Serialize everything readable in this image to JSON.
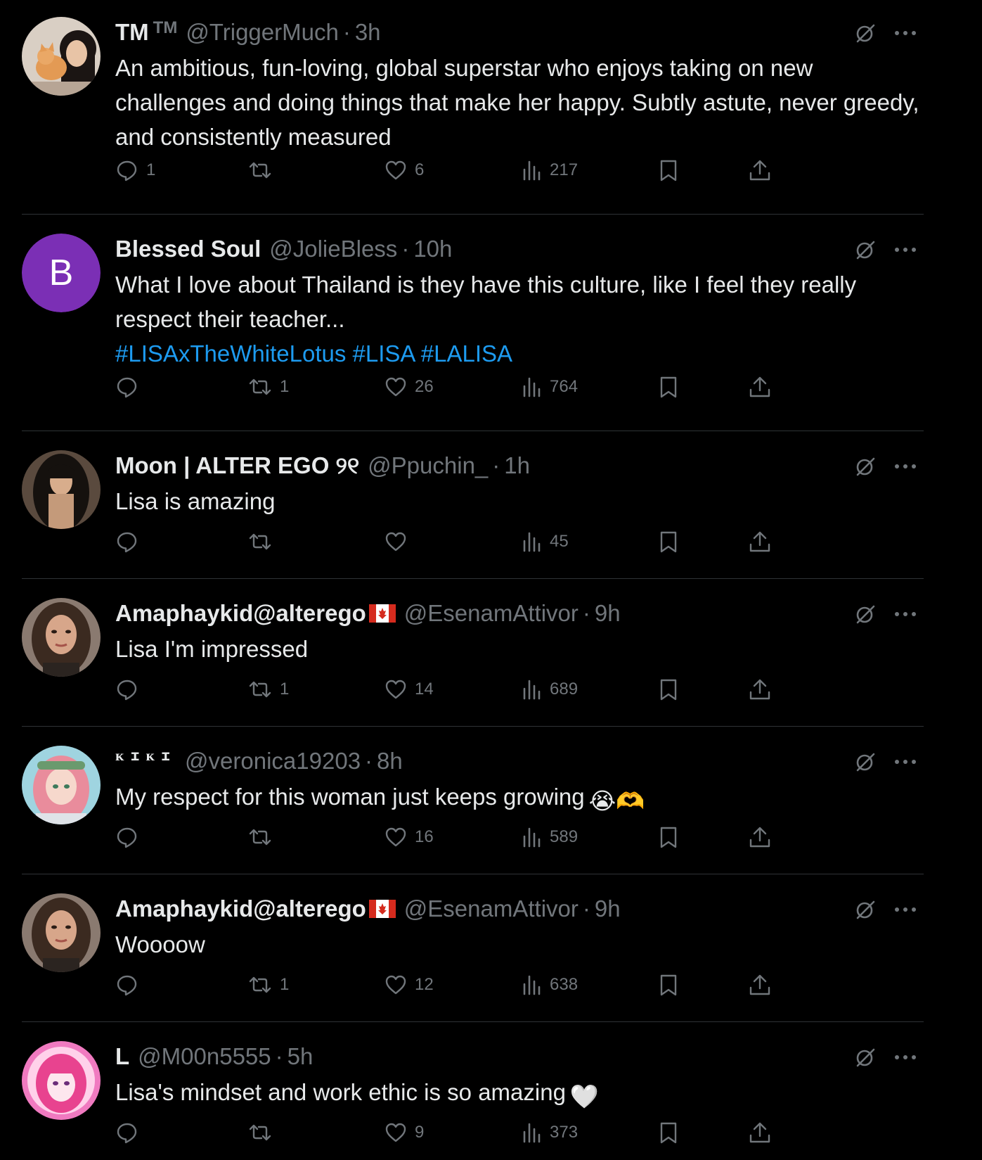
{
  "colors": {
    "background": "#000000",
    "text_primary": "#e7e9ea",
    "text_secondary": "#71767b",
    "link": "#1d9bf0",
    "divider": "#2f3336",
    "avatar_purple": "#7b2fb5"
  },
  "tweets": [
    {
      "display_name": "TM",
      "name_suffix": "TM",
      "handle": "@TriggerMuch",
      "separator": "·",
      "time": "3h",
      "text": "An ambitious, fun-loving, global superstar who enjoys taking on new challenges and doing things that make her happy. Subtly astute, never greedy, and consistently measured",
      "hashtags": "",
      "emoji": "",
      "avatar": {
        "type": "photo",
        "icon": "woman-with-cat-avatar"
      },
      "replies": "1",
      "reposts": "",
      "likes": "6",
      "views": "217"
    },
    {
      "display_name": "Blessed Soul",
      "handle": "@JolieBless",
      "separator": "·",
      "time": "10h",
      "text": "What I love about Thailand is they have this culture, like I feel they really respect their teacher...",
      "hashtags": "#LISAxTheWhiteLotus #LISA #LALISA",
      "emoji": "",
      "avatar": {
        "type": "letter",
        "letter": "B",
        "color": "#7b2fb5"
      },
      "replies": "",
      "reposts": "1",
      "likes": "26",
      "views": "764"
    },
    {
      "display_name": "Moon | ALTER EGO ୨୧",
      "handle": "@Ppuchin_",
      "separator": "·",
      "time": "1h",
      "text": "Lisa is amazing",
      "hashtags": "",
      "emoji": "",
      "avatar": {
        "type": "photo",
        "icon": "dark-hair-woman-avatar"
      },
      "replies": "",
      "reposts": "",
      "likes": "",
      "views": "45"
    },
    {
      "display_name": "Amaphaykid@alterego",
      "flag": "canada-flag-icon",
      "handle": "@EsenamAttivor",
      "separator": "·",
      "time": "9h",
      "text": "Lisa I'm impressed",
      "hashtags": "",
      "emoji": "",
      "avatar": {
        "type": "photo",
        "icon": "woman-portrait-avatar"
      },
      "replies": "",
      "reposts": "1",
      "likes": "14",
      "views": "689"
    },
    {
      "display_name": "ᴋɪᴋɪ",
      "handle": "@veronica19203",
      "separator": "·",
      "time": "8h",
      "text": "My respect for this woman just keeps growing",
      "hashtags": "",
      "emoji": "😭🫶",
      "avatar": {
        "type": "photo",
        "icon": "anime-girl-avatar"
      },
      "replies": "",
      "reposts": "",
      "likes": "16",
      "views": "589"
    },
    {
      "display_name": "Amaphaykid@alterego",
      "flag": "canada-flag-icon",
      "handle": "@EsenamAttivor",
      "separator": "·",
      "time": "9h",
      "text": "Woooow",
      "hashtags": "",
      "emoji": "",
      "avatar": {
        "type": "photo",
        "icon": "woman-portrait-avatar"
      },
      "replies": "",
      "reposts": "1",
      "likes": "12",
      "views": "638"
    },
    {
      "display_name": "L",
      "handle": "@M00n5555",
      "separator": "·",
      "time": "5h",
      "text": "Lisa's mindset and work ethic is so amazing",
      "hashtags": "",
      "emoji": "🤍",
      "avatar": {
        "type": "photo",
        "icon": "pink-anime-avatar"
      },
      "replies": "",
      "reposts": "",
      "likes": "9",
      "views": "373"
    }
  ]
}
